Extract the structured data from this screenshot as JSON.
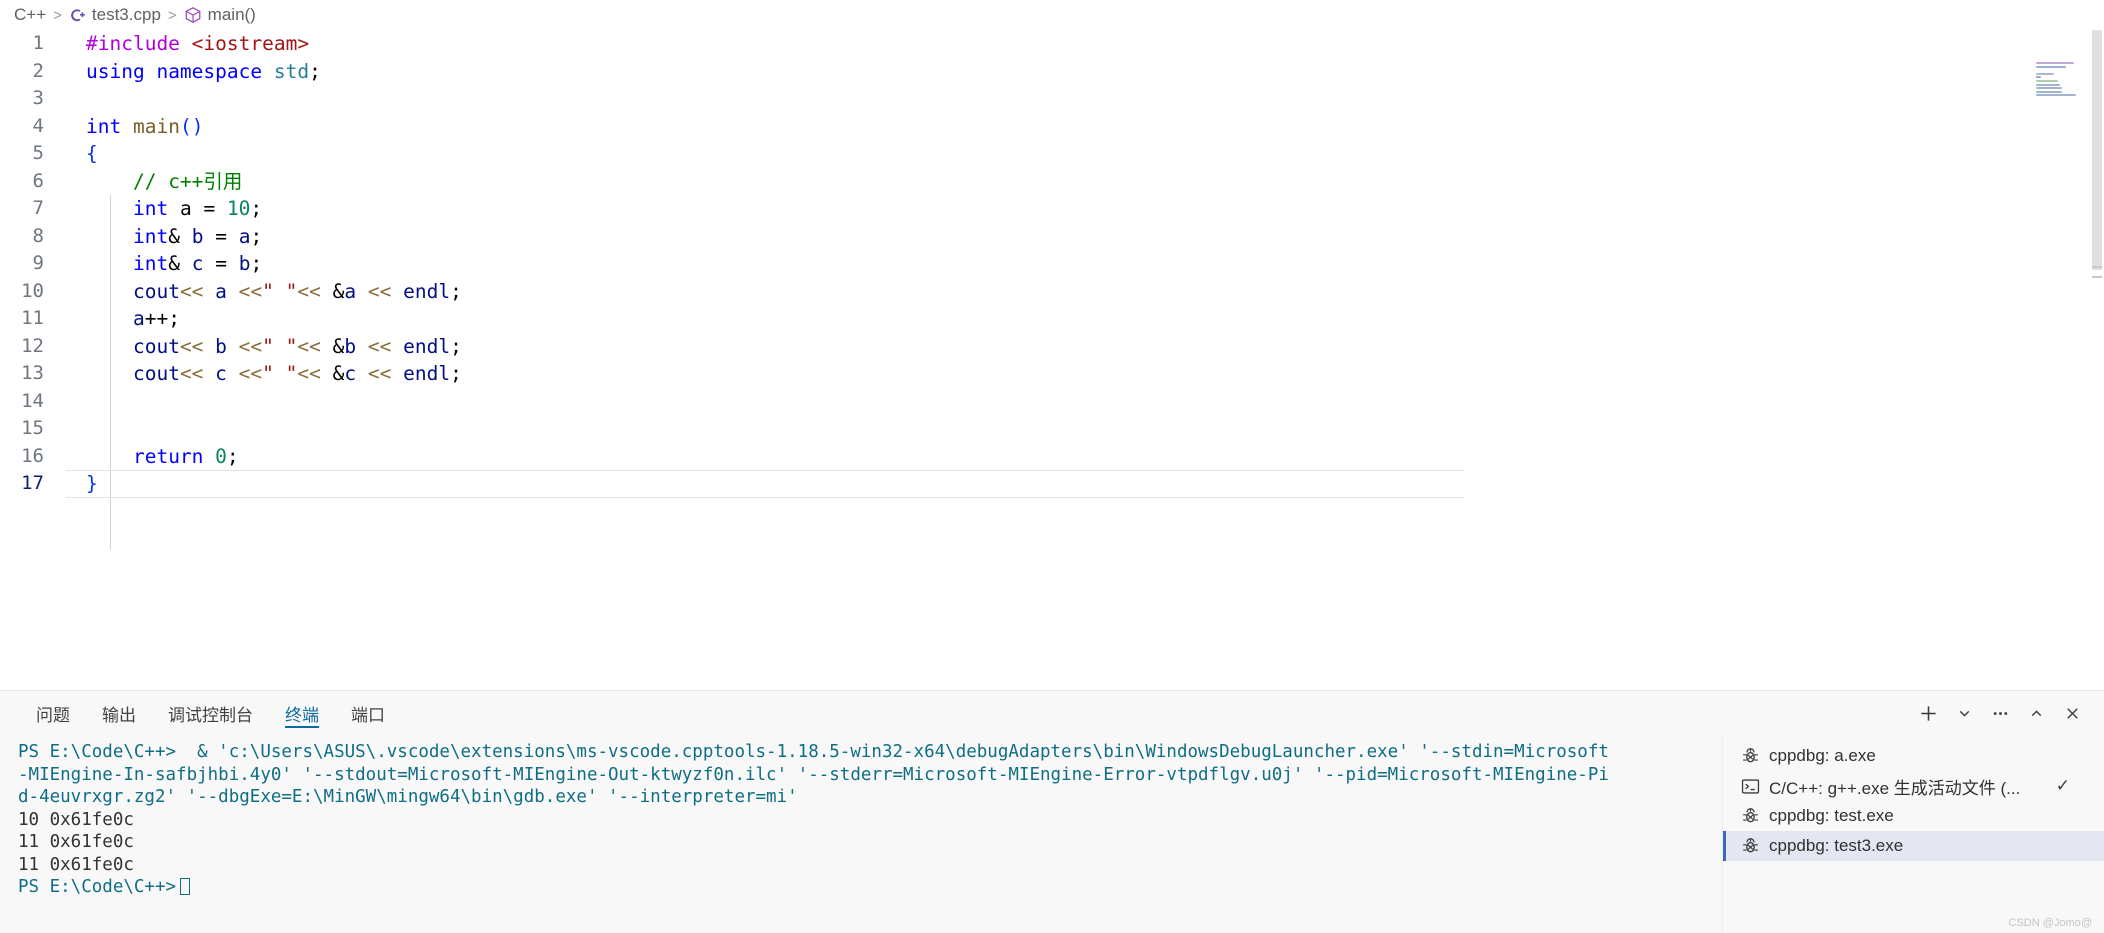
{
  "breadcrumb": {
    "items": [
      {
        "label": "C++",
        "icon": "none"
      },
      {
        "label": "test3.cpp",
        "icon": "cpp-file-icon"
      },
      {
        "label": "main()",
        "icon": "symbol-method-icon"
      }
    ],
    "separator": ">"
  },
  "editor": {
    "language": "C++",
    "file": "test3.cpp",
    "lines": [
      {
        "n": "1",
        "tokens": [
          {
            "t": "#include",
            "c": "t-pre"
          },
          {
            "t": " ",
            "c": "t-punc"
          },
          {
            "t": "<iostream>",
            "c": "t-str"
          }
        ]
      },
      {
        "n": "2",
        "tokens": [
          {
            "t": "using",
            "c": "t-kw"
          },
          {
            "t": " ",
            "c": "t-punc"
          },
          {
            "t": "namespace",
            "c": "t-kw"
          },
          {
            "t": " ",
            "c": "t-punc"
          },
          {
            "t": "std",
            "c": "t-ns"
          },
          {
            "t": ";",
            "c": "t-punc"
          }
        ]
      },
      {
        "n": "3",
        "tokens": []
      },
      {
        "n": "4",
        "tokens": [
          {
            "t": "int",
            "c": "t-kw"
          },
          {
            "t": " ",
            "c": "t-punc"
          },
          {
            "t": "main",
            "c": "t-func"
          },
          {
            "t": "()",
            "c": "t-paren"
          }
        ]
      },
      {
        "n": "5",
        "tokens": [
          {
            "t": "{",
            "c": "t-brace"
          }
        ]
      },
      {
        "n": "6",
        "tokens": [
          {
            "t": "    ",
            "c": "t-punc"
          },
          {
            "t": "// c++引用",
            "c": "t-com"
          }
        ]
      },
      {
        "n": "7",
        "tokens": [
          {
            "t": "    ",
            "c": "t-punc"
          },
          {
            "t": "int",
            "c": "t-kw"
          },
          {
            "t": " a ",
            "c": "t-punc"
          },
          {
            "t": "=",
            "c": "t-punc"
          },
          {
            "t": " ",
            "c": "t-punc"
          },
          {
            "t": "10",
            "c": "t-num"
          },
          {
            "t": ";",
            "c": "t-punc"
          }
        ]
      },
      {
        "n": "8",
        "tokens": [
          {
            "t": "    ",
            "c": "t-punc"
          },
          {
            "t": "int",
            "c": "t-kw"
          },
          {
            "t": "&",
            "c": "t-amp"
          },
          {
            "t": " ",
            "c": "t-punc"
          },
          {
            "t": "b",
            "c": "t-var"
          },
          {
            "t": " = ",
            "c": "t-punc"
          },
          {
            "t": "a",
            "c": "t-var"
          },
          {
            "t": ";",
            "c": "t-punc"
          }
        ]
      },
      {
        "n": "9",
        "tokens": [
          {
            "t": "    ",
            "c": "t-punc"
          },
          {
            "t": "int",
            "c": "t-kw"
          },
          {
            "t": "&",
            "c": "t-amp"
          },
          {
            "t": " ",
            "c": "t-punc"
          },
          {
            "t": "c",
            "c": "t-var"
          },
          {
            "t": " = ",
            "c": "t-punc"
          },
          {
            "t": "b",
            "c": "t-var"
          },
          {
            "t": ";",
            "c": "t-punc"
          }
        ]
      },
      {
        "n": "10",
        "tokens": [
          {
            "t": "    ",
            "c": "t-punc"
          },
          {
            "t": "cout",
            "c": "t-var"
          },
          {
            "t": "<<",
            "c": "t-op"
          },
          {
            "t": " ",
            "c": "t-punc"
          },
          {
            "t": "a",
            "c": "t-var"
          },
          {
            "t": " ",
            "c": "t-punc"
          },
          {
            "t": "<<",
            "c": "t-op"
          },
          {
            "t": "\" \"",
            "c": "t-str"
          },
          {
            "t": "<<",
            "c": "t-op"
          },
          {
            "t": " ",
            "c": "t-punc"
          },
          {
            "t": "&",
            "c": "t-amp"
          },
          {
            "t": "a",
            "c": "t-var"
          },
          {
            "t": " ",
            "c": "t-punc"
          },
          {
            "t": "<<",
            "c": "t-op"
          },
          {
            "t": " ",
            "c": "t-punc"
          },
          {
            "t": "endl",
            "c": "t-var"
          },
          {
            "t": ";",
            "c": "t-punc"
          }
        ]
      },
      {
        "n": "11",
        "tokens": [
          {
            "t": "    ",
            "c": "t-punc"
          },
          {
            "t": "a",
            "c": "t-var"
          },
          {
            "t": "++;",
            "c": "t-punc"
          }
        ]
      },
      {
        "n": "12",
        "tokens": [
          {
            "t": "    ",
            "c": "t-punc"
          },
          {
            "t": "cout",
            "c": "t-var"
          },
          {
            "t": "<<",
            "c": "t-op"
          },
          {
            "t": " ",
            "c": "t-punc"
          },
          {
            "t": "b",
            "c": "t-var"
          },
          {
            "t": " ",
            "c": "t-punc"
          },
          {
            "t": "<<",
            "c": "t-op"
          },
          {
            "t": "\" \"",
            "c": "t-str"
          },
          {
            "t": "<<",
            "c": "t-op"
          },
          {
            "t": " ",
            "c": "t-punc"
          },
          {
            "t": "&",
            "c": "t-amp"
          },
          {
            "t": "b",
            "c": "t-var"
          },
          {
            "t": " ",
            "c": "t-punc"
          },
          {
            "t": "<<",
            "c": "t-op"
          },
          {
            "t": " ",
            "c": "t-punc"
          },
          {
            "t": "endl",
            "c": "t-var"
          },
          {
            "t": ";",
            "c": "t-punc"
          }
        ]
      },
      {
        "n": "13",
        "tokens": [
          {
            "t": "    ",
            "c": "t-punc"
          },
          {
            "t": "cout",
            "c": "t-var"
          },
          {
            "t": "<<",
            "c": "t-op"
          },
          {
            "t": " ",
            "c": "t-punc"
          },
          {
            "t": "c",
            "c": "t-var"
          },
          {
            "t": " ",
            "c": "t-punc"
          },
          {
            "t": "<<",
            "c": "t-op"
          },
          {
            "t": "\" \"",
            "c": "t-str"
          },
          {
            "t": "<<",
            "c": "t-op"
          },
          {
            "t": " ",
            "c": "t-punc"
          },
          {
            "t": "&",
            "c": "t-amp"
          },
          {
            "t": "c",
            "c": "t-var"
          },
          {
            "t": " ",
            "c": "t-punc"
          },
          {
            "t": "<<",
            "c": "t-op"
          },
          {
            "t": " ",
            "c": "t-punc"
          },
          {
            "t": "endl",
            "c": "t-var"
          },
          {
            "t": ";",
            "c": "t-punc"
          }
        ]
      },
      {
        "n": "14",
        "tokens": []
      },
      {
        "n": "15",
        "tokens": []
      },
      {
        "n": "16",
        "tokens": [
          {
            "t": "    ",
            "c": "t-punc"
          },
          {
            "t": "return",
            "c": "t-kw"
          },
          {
            "t": " ",
            "c": "t-punc"
          },
          {
            "t": "0",
            "c": "t-num"
          },
          {
            "t": ";",
            "c": "t-punc"
          }
        ]
      },
      {
        "n": "17",
        "tokens": [
          {
            "t": "}",
            "c": "t-brace"
          }
        ]
      }
    ],
    "active_line": "17"
  },
  "panel": {
    "tabs": [
      {
        "label": "问题",
        "active": false
      },
      {
        "label": "输出",
        "active": false
      },
      {
        "label": "调试控制台",
        "active": false
      },
      {
        "label": "终端",
        "active": true
      },
      {
        "label": "端口",
        "active": false
      }
    ],
    "actions": [
      {
        "name": "new-terminal-button",
        "icon": "plus-icon"
      },
      {
        "name": "terminal-split-dropdown",
        "icon": "chevron-down-icon"
      },
      {
        "name": "panel-more-actions",
        "icon": "ellipsis-icon"
      },
      {
        "name": "maximize-panel-button",
        "icon": "chevron-up-icon"
      },
      {
        "name": "close-panel-button",
        "icon": "close-icon"
      }
    ]
  },
  "terminal": {
    "lines": [
      {
        "text": "PS E:\\Code\\C++>  & 'c:\\Users\\ASUS\\.vscode\\extensions\\ms-vscode.cpptools-1.18.5-win32-x64\\debugAdapters\\bin\\WindowsDebugLauncher.exe' '--stdin=Microsoft",
        "style": "prompt"
      },
      {
        "text": "-MIEngine-In-safbjhbi.4y0' '--stdout=Microsoft-MIEngine-Out-ktwyzf0n.ilc' '--stderr=Microsoft-MIEngine-Error-vtpdflgv.u0j' '--pid=Microsoft-MIEngine-Pi",
        "style": "prompt"
      },
      {
        "text": "d-4euvrxgr.zg2' '--dbgExe=E:\\MinGW\\mingw64\\bin\\gdb.exe' '--interpreter=mi'",
        "style": "prompt"
      },
      {
        "text": "10 0x61fe0c",
        "style": "output"
      },
      {
        "text": "11 0x61fe0c",
        "style": "output"
      },
      {
        "text": "11 0x61fe0c",
        "style": "output"
      },
      {
        "text": "PS E:\\Code\\C++>",
        "style": "prompt-cursor"
      }
    ]
  },
  "debug_sessions": [
    {
      "label": "cppdbg: a.exe",
      "icon": "debug-bug-icon",
      "selected": false,
      "check": ""
    },
    {
      "label": "C/C++: g++.exe 生成活动文件 (...",
      "icon": "terminal-icon",
      "selected": false,
      "check": "✓"
    },
    {
      "label": "cppdbg: test.exe",
      "icon": "debug-bug-icon",
      "selected": false,
      "check": ""
    },
    {
      "label": "cppdbg: test3.exe",
      "icon": "debug-bug-icon",
      "selected": true,
      "check": ""
    }
  ],
  "watermark": "CSDN @Jomo@",
  "colors": {
    "accent": "#0b6a9e",
    "terminal_text": "#0f6e84",
    "selection": "#e4e6f1",
    "selection_bar": "#3a66c4"
  }
}
